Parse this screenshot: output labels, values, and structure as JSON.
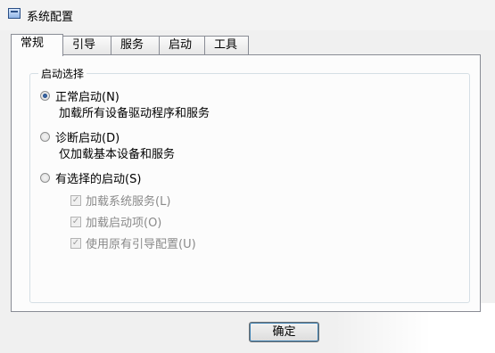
{
  "window": {
    "title": "系统配置",
    "icon": "system-config-icon"
  },
  "tabs": [
    {
      "label": "常规",
      "active": true
    },
    {
      "label": "引导",
      "active": false
    },
    {
      "label": "服务",
      "active": false
    },
    {
      "label": "启动",
      "active": false
    },
    {
      "label": "工具",
      "active": false
    }
  ],
  "startup": {
    "legend": "启动选择",
    "normal": {
      "label": "正常启动(N)",
      "desc": "加载所有设备驱动程序和服务",
      "checked": true
    },
    "diagnostic": {
      "label": "诊断启动(D)",
      "desc": "仅加载基本设备和服务",
      "checked": false
    },
    "selective": {
      "label": "有选择的启动(S)",
      "checked": false,
      "options": [
        {
          "label": "加载系统服务(L)",
          "checked": true,
          "enabled": false
        },
        {
          "label": "加载启动项(O)",
          "checked": true,
          "enabled": false
        },
        {
          "label": "使用原有引导配置(U)",
          "checked": true,
          "enabled": false
        }
      ]
    }
  },
  "buttons": {
    "ok": "确定"
  }
}
